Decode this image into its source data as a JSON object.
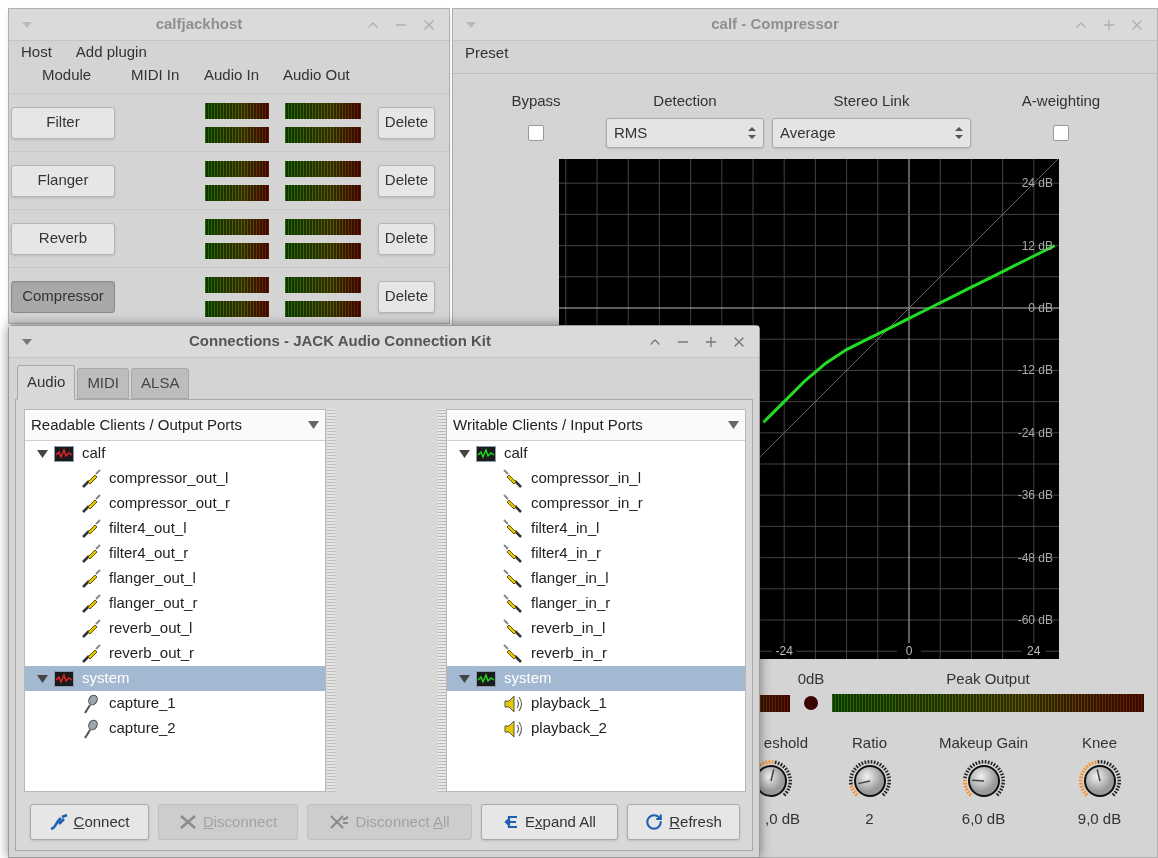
{
  "host": {
    "title": "calfjackhost",
    "active": false,
    "menu": [
      "Host",
      "Add plugin"
    ],
    "columns": [
      "Module",
      "MIDI In",
      "Audio In",
      "Audio Out"
    ],
    "plugins": [
      {
        "name": "Filter",
        "active": false,
        "delete": "Delete"
      },
      {
        "name": "Flanger",
        "active": false,
        "delete": "Delete"
      },
      {
        "name": "Reverb",
        "active": false,
        "delete": "Delete"
      },
      {
        "name": "Compressor",
        "active": true,
        "delete": "Delete"
      }
    ]
  },
  "compressor": {
    "title": "calf - Compressor",
    "active": false,
    "menu": [
      "Preset"
    ],
    "controls": [
      {
        "kind": "checkbox",
        "label": "Bypass",
        "checked": false
      },
      {
        "kind": "select",
        "label": "Detection",
        "value": "RMS"
      },
      {
        "kind": "select",
        "label": "Stereo Link",
        "value": "Average"
      },
      {
        "kind": "checkbox",
        "label": "A-weighting",
        "checked": false
      }
    ],
    "chart_data": {
      "type": "line",
      "x": [
        -28,
        -24,
        -20,
        -16,
        -12,
        -8,
        -4,
        0,
        4,
        8,
        12,
        16,
        20,
        24,
        28
      ],
      "series": [
        {
          "color": "#22dd22",
          "values": [
            -22,
            -18,
            -14,
            -10.6,
            -8,
            -6,
            -4,
            -2,
            0,
            2,
            4,
            6,
            8,
            10,
            12
          ]
        }
      ],
      "xlim": [
        -67,
        29
      ],
      "ylim": [
        -67,
        29
      ],
      "grid": true,
      "xticks": [
        -24,
        0,
        24
      ],
      "yticks": [
        {
          "value": 24,
          "label": "24 dB"
        },
        {
          "value": 12,
          "label": "12 dB"
        },
        {
          "value": 0,
          "label": "0 dB"
        },
        {
          "value": -12,
          "label": "-12 dB"
        },
        {
          "value": -24,
          "label": "-24 dB"
        },
        {
          "value": -36,
          "label": "-36 dB"
        },
        {
          "value": -48,
          "label": "-48 dB"
        },
        {
          "value": -60,
          "label": "-60 dB"
        }
      ]
    },
    "clip_label": "0dB",
    "clip": false,
    "peak_label": "Peak Output",
    "knobs": [
      {
        "label": "eshold",
        "value": ",0 dB"
      },
      {
        "label": "Ratio",
        "value": "2"
      },
      {
        "label": "Makeup Gain",
        "value": "6,0 dB"
      },
      {
        "label": "Knee",
        "value": "9,0 dB"
      }
    ]
  },
  "connections": {
    "title": "Connections - JACK Audio Connection Kit",
    "active": true,
    "tabs": [
      {
        "label": "Audio",
        "selected": true
      },
      {
        "label": "MIDI",
        "selected": false
      },
      {
        "label": "ALSA",
        "selected": false
      }
    ],
    "panels": [
      {
        "kind": "output",
        "header": "Readable Clients / Output Ports",
        "clients": [
          {
            "name": "calf",
            "expanded": true,
            "selected": false,
            "ports": [
              {
                "name": "compressor_out_l",
                "kind": "plug",
                "selected": false
              },
              {
                "name": "compressor_out_r",
                "kind": "plug",
                "selected": false
              },
              {
                "name": "filter4_out_l",
                "kind": "plug",
                "selected": false
              },
              {
                "name": "filter4_out_r",
                "kind": "plug",
                "selected": false
              },
              {
                "name": "flanger_out_l",
                "kind": "plug",
                "selected": false
              },
              {
                "name": "flanger_out_r",
                "kind": "plug",
                "selected": false
              },
              {
                "name": "reverb_out_l",
                "kind": "plug",
                "selected": false
              },
              {
                "name": "reverb_out_r",
                "kind": "plug",
                "selected": false
              }
            ]
          },
          {
            "name": "system",
            "expanded": true,
            "selected": true,
            "ports": [
              {
                "name": "capture_1",
                "kind": "mic",
                "selected": false
              },
              {
                "name": "capture_2",
                "kind": "mic",
                "selected": false
              }
            ]
          }
        ]
      },
      {
        "kind": "input",
        "header": "Writable Clients / Input Ports",
        "clients": [
          {
            "name": "calf",
            "expanded": true,
            "selected": false,
            "ports": [
              {
                "name": "compressor_in_l",
                "kind": "plug",
                "selected": false
              },
              {
                "name": "compressor_in_r",
                "kind": "plug",
                "selected": false
              },
              {
                "name": "filter4_in_l",
                "kind": "plug",
                "selected": false
              },
              {
                "name": "filter4_in_r",
                "kind": "plug",
                "selected": false
              },
              {
                "name": "flanger_in_l",
                "kind": "plug",
                "selected": false
              },
              {
                "name": "flanger_in_r",
                "kind": "plug",
                "selected": false
              },
              {
                "name": "reverb_in_l",
                "kind": "plug",
                "selected": false
              },
              {
                "name": "reverb_in_r",
                "kind": "plug",
                "selected": false
              }
            ]
          },
          {
            "name": "system",
            "expanded": true,
            "selected": true,
            "ports": [
              {
                "name": "playback_1",
                "kind": "speaker",
                "selected": false
              },
              {
                "name": "playback_2",
                "kind": "speaker",
                "selected": false
              }
            ]
          }
        ]
      }
    ],
    "buttons": [
      {
        "kind": "connect",
        "key": "C",
        "after": "onnect",
        "disabled": false
      },
      {
        "kind": "disconnect",
        "key": "D",
        "after": "isconnect",
        "disabled": true
      },
      {
        "kind": "disconnect_all",
        "before": "Disconnect ",
        "key": "A",
        "after": "ll",
        "disabled": true
      },
      {
        "kind": "expand",
        "before": "E",
        "key": "x",
        "after": "pand All",
        "disabled": false
      },
      {
        "kind": "refresh",
        "key": "R",
        "after": "efresh",
        "disabled": false
      }
    ]
  }
}
